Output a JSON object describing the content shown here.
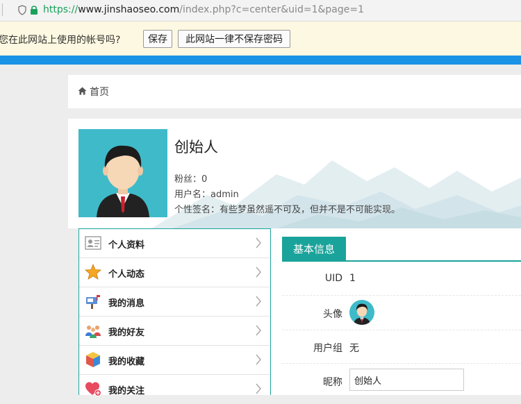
{
  "browser": {
    "url_scheme": "https://",
    "url_host": "www.jinshaoseo.com",
    "url_path": "/index.php?c=center&uid=1&page=1"
  },
  "password_bar": {
    "question": "您在此网站上使用的帐号吗?",
    "save_label": "保存",
    "never_label": "此网站一律不保存密码"
  },
  "breadcrumb": {
    "home_label": "首页"
  },
  "profile": {
    "name": "创始人",
    "fans": "粉丝：0",
    "username": "用户名：admin",
    "signature": "个性签名：有些梦虽然遥不可及，但并不是不可能实现。"
  },
  "menu": {
    "items": [
      {
        "label": "个人资料",
        "icon": "id-card-icon"
      },
      {
        "label": "个人动态",
        "icon": "star-icon"
      },
      {
        "label": "我的消息",
        "icon": "mailbox-icon"
      },
      {
        "label": "我的好友",
        "icon": "friends-icon"
      },
      {
        "label": "我的收藏",
        "icon": "cube-icon"
      },
      {
        "label": "我的关注",
        "icon": "heart-plus-icon"
      }
    ]
  },
  "panel": {
    "tab_label": "基本信息",
    "uid_label": "UID",
    "uid_value": "1",
    "avatar_label": "头像",
    "group_label": "用户组",
    "group_value": "无",
    "nickname_label": "昵称",
    "nickname_value": "创始人"
  },
  "colors": {
    "accent": "#1aa39a",
    "browser_blue": "#1a92e6",
    "avatar_bg": "#3fbac9",
    "prompt_bg": "#fdf8e1"
  }
}
